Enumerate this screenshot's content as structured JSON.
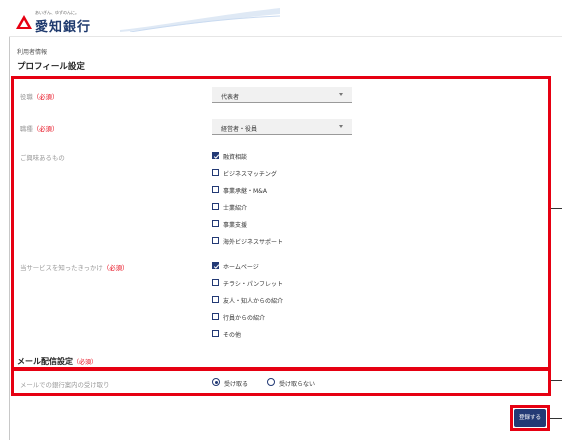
{
  "header": {
    "bank_name": "愛知銀行",
    "tagline": "あいぎん、ゆずのんに。"
  },
  "breadcrumb": "利用者情報",
  "page_title": "プロフィール設定",
  "profile": {
    "position": {
      "label": "役職",
      "required": "（必須）",
      "value": "代表者"
    },
    "job_type": {
      "label": "職種",
      "required": "（必須）",
      "value": "経営者・役員"
    },
    "interests": {
      "label": "ご興味あるもの",
      "options": [
        {
          "label": "融資相談",
          "checked": true
        },
        {
          "label": "ビジネスマッチング",
          "checked": false
        },
        {
          "label": "事業承継・M&A",
          "checked": false
        },
        {
          "label": "士業紹介",
          "checked": false
        },
        {
          "label": "事業支援",
          "checked": false
        },
        {
          "label": "海外ビジネスサポート",
          "checked": false
        }
      ]
    },
    "referral": {
      "label": "当サービスを知ったきっかけ",
      "required": "（必須）",
      "options": [
        {
          "label": "ホームページ",
          "checked": true
        },
        {
          "label": "チラシ・パンフレット",
          "checked": false
        },
        {
          "label": "友人・知人からの紹介",
          "checked": false
        },
        {
          "label": "行員からの紹介",
          "checked": false
        },
        {
          "label": "その他",
          "checked": false
        }
      ]
    }
  },
  "mail": {
    "title": "メール配信設定",
    "required": "（必須）",
    "label": "メールでの銀行案内の受け取り",
    "options": [
      {
        "label": "受け取る",
        "selected": true
      },
      {
        "label": "受け取らない",
        "selected": false
      }
    ]
  },
  "submit_label": "登録する",
  "colors": {
    "accent": "#e60012",
    "navy": "#233a75"
  }
}
